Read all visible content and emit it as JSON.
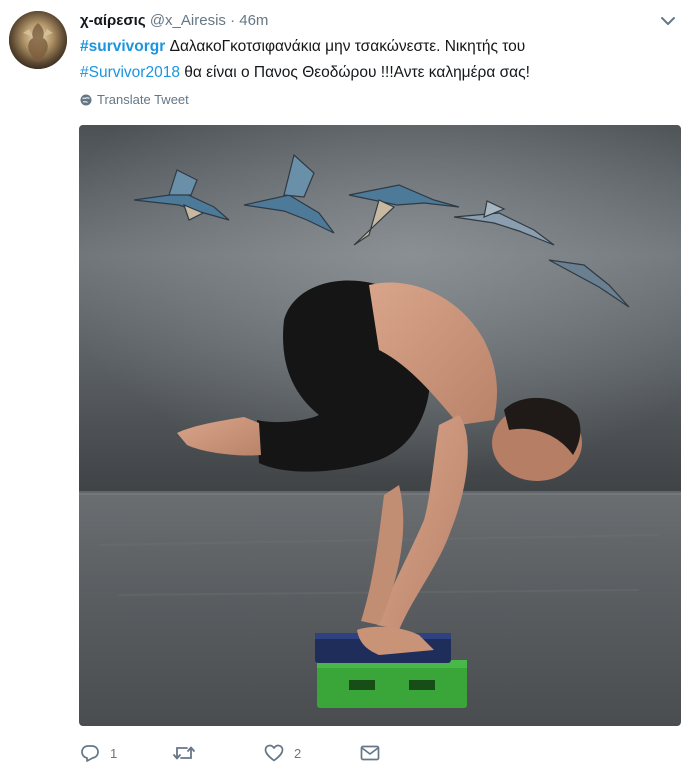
{
  "author": {
    "display_name": "χ-αίρεσις",
    "screen_name": "@x_Airesis",
    "separator": "·",
    "time": "46m"
  },
  "text": {
    "hashtag1": "#survivorgr",
    "line1_rest": " ΔαλακοΓκοτσιφανάκια μην τσακώνεστε. Νικητής του",
    "hashtag2": "#Survivor2018",
    "line2_rest": " θα είναι ο Πανος Θεοδώρου !!!Αντε καλημέρα σας!"
  },
  "translate_label": "Translate Tweet",
  "icons": {
    "caret": "chevron-down-icon",
    "globe": "globe-icon",
    "reply": "reply-icon",
    "retweet": "retweet-icon",
    "like": "heart-icon",
    "dm": "envelope-icon"
  },
  "actions": {
    "reply_count": "1",
    "like_count": "2"
  },
  "colors": {
    "hashtag": "#1b95e0",
    "muted": "#657786",
    "text": "#14171a"
  }
}
